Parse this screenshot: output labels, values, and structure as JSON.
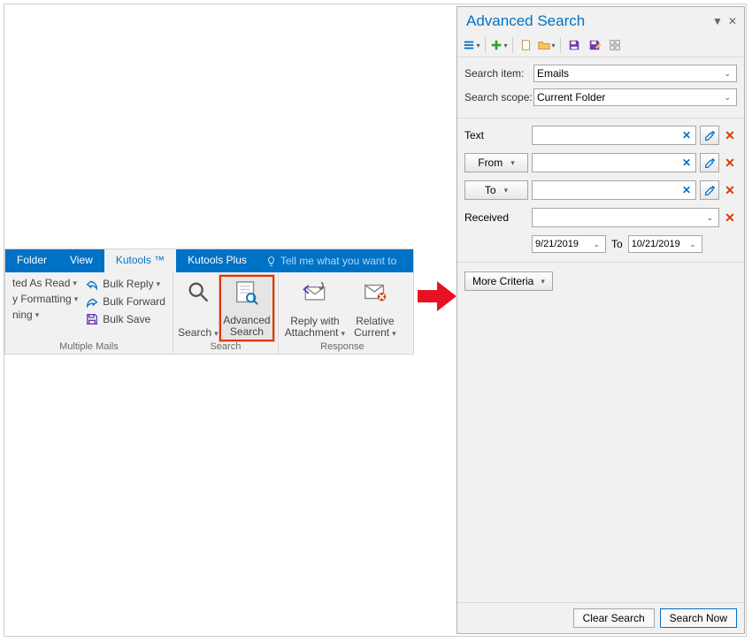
{
  "ribbon": {
    "tabs": {
      "folder": "Folder",
      "view": "View",
      "kutools": "Kutools ™",
      "kutoolsplus": "Kutools Plus"
    },
    "tell_me": "Tell me what you want to",
    "group_multiple": {
      "title": "Multiple Mails",
      "items": {
        "read": "ted As Read",
        "format": "y Formatting",
        "ning": "ning",
        "bulk_reply": "Bulk Reply",
        "bulk_forward": "Bulk Forward",
        "bulk_save": "Bulk Save"
      }
    },
    "group_search": {
      "title": "Search",
      "search": "Search",
      "adv": "Advanced Search"
    },
    "group_response": {
      "title": "Response",
      "reply": "Reply with Attachment",
      "relative": "Relative Current"
    }
  },
  "panel": {
    "title": "Advanced Search",
    "fields": {
      "search_item_label": "Search item:",
      "search_item_value": "Emails",
      "search_scope_label": "Search scope:",
      "search_scope_value": "Current Folder",
      "text_label": "Text",
      "from_label": "From",
      "to_label": "To",
      "received_label": "Received",
      "date_from": "9/21/2019",
      "date_to_label": "To",
      "date_to": "10/21/2019"
    },
    "more_criteria": "More Criteria",
    "clear": "Clear Search",
    "search_now": "Search Now"
  }
}
